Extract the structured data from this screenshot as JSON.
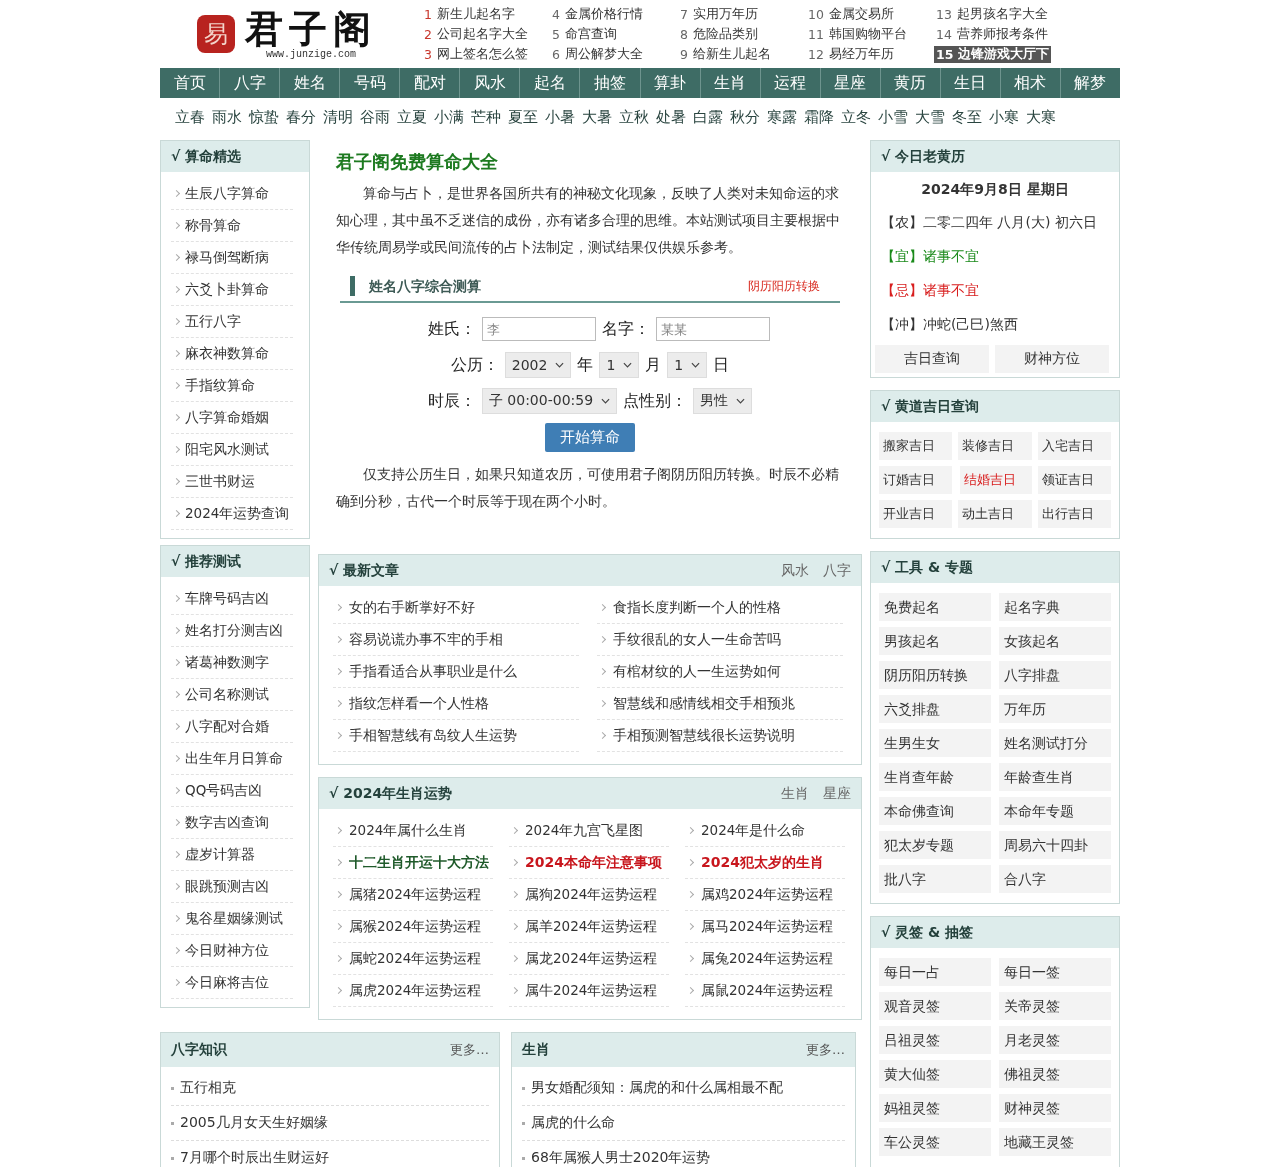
{
  "header": {
    "logo": {
      "seal": "易",
      "name": "君子阁",
      "url": "www.junzige.com"
    },
    "hot_links": [
      {
        "rank": "1",
        "text": "新生儿起名字",
        "top": true,
        "highlighted": false
      },
      {
        "rank": "2",
        "text": "公司起名字大全",
        "top": true,
        "highlighted": false
      },
      {
        "rank": "3",
        "text": "网上签名怎么签",
        "top": true,
        "highlighted": false
      },
      {
        "rank": "4",
        "text": "金属价格行情",
        "top": false,
        "highlighted": false
      },
      {
        "rank": "5",
        "text": "命宫查询",
        "top": false,
        "highlighted": false
      },
      {
        "rank": "6",
        "text": "周公解梦大全",
        "top": false,
        "highlighted": false
      },
      {
        "rank": "7",
        "text": "实用万年历",
        "top": false,
        "highlighted": false
      },
      {
        "rank": "8",
        "text": "危险品类别",
        "top": false,
        "highlighted": false
      },
      {
        "rank": "9",
        "text": "给新生儿起名",
        "top": false,
        "highlighted": false
      },
      {
        "rank": "10",
        "text": "金属交易所",
        "top": false,
        "highlighted": false
      },
      {
        "rank": "11",
        "text": "韩国购物平台",
        "top": false,
        "highlighted": false
      },
      {
        "rank": "12",
        "text": "易经万年历",
        "top": false,
        "highlighted": false
      },
      {
        "rank": "13",
        "text": "起男孩名字大全",
        "top": false,
        "highlighted": false
      },
      {
        "rank": "14",
        "text": "营养师报考条件",
        "top": false,
        "highlighted": false
      },
      {
        "rank": "15",
        "text": "边锋游戏大厅下",
        "top": false,
        "highlighted": true
      }
    ]
  },
  "nav": [
    "首页",
    "八字",
    "姓名",
    "号码",
    "配对",
    "风水",
    "起名",
    "抽签",
    "算卦",
    "生肖",
    "运程",
    "星座",
    "黄历",
    "生日",
    "相术",
    "解梦"
  ],
  "solar_terms": [
    "立春",
    "雨水",
    "惊蛰",
    "春分",
    "清明",
    "谷雨",
    "立夏",
    "小满",
    "芒种",
    "夏至",
    "小暑",
    "大暑",
    "立秋",
    "处暑",
    "白露",
    "秋分",
    "寒露",
    "霜降",
    "立冬",
    "小雪",
    "大雪",
    "冬至",
    "小寒",
    "大寒"
  ],
  "sidebar_sections": [
    {
      "title": "√ 算命精选",
      "items": [
        "生辰八字算命",
        "称骨算命",
        "禄马倒驾断病",
        "六爻卜卦算命",
        "五行八字",
        "麻衣神数算命",
        "手指纹算命",
        "八字算命婚姻",
        "阳宅风水测试",
        "三世书财运",
        "2024年运势查询"
      ]
    },
    {
      "title": "√ 推荐测试",
      "items": [
        "车牌号码吉凶",
        "姓名打分测吉凶",
        "诸葛神数测字",
        "公司名称测试",
        "八字配对合婚",
        "出生年月日算命",
        "QQ号码吉凶",
        "数字吉凶查询",
        "虚岁计算器",
        "眼跳预测吉凶",
        "鬼谷星姻缘测试",
        "今日财神方位",
        "今日麻将吉位"
      ]
    }
  ],
  "intro": {
    "title": "君子阁免费算命大全",
    "paragraphs": [
      "算命与占卜，是世界各国所共有的神秘文化现象，反映了人类对未知命运的求知心理，其中虽不乏迷信的成份，亦有诸多合理的思维。本站测试项目主要根据中华传统周易学或民间流传的占卜法制定，测试结果仅供娱乐参考。"
    ]
  },
  "calculator": {
    "title": "姓名八字综合测算",
    "link": "阴历阳历转换",
    "rows": [
      {
        "fields": [
          {
            "label": "姓氏：",
            "kind": "input",
            "placeholder": "李"
          },
          {
            "label": "名字：",
            "kind": "input",
            "placeholder": "某某"
          }
        ]
      },
      {
        "fields": [
          {
            "label": "公历：",
            "kind": "select",
            "value": "2002",
            "suffix": "年"
          },
          {
            "kind": "select",
            "value": "1",
            "suffix": "月"
          },
          {
            "kind": "select",
            "value": "1",
            "suffix": "日"
          }
        ]
      },
      {
        "fields": [
          {
            "label": "时辰：",
            "kind": "select",
            "value": "子 00:00-00:59"
          },
          {
            "label": "点性别：",
            "kind": "select",
            "value": "男性"
          }
        ]
      }
    ],
    "button": "开始算命",
    "note": "仅支持公历生日，如果只知道农历，可使用君子阁阴历阳历转换。时辰不必精确到分秒，古代一个时辰等于现在两个小时。"
  },
  "articles": {
    "title": "√ 最新文章",
    "tabs": [
      "风水",
      "八字"
    ],
    "items": [
      "女的右手断掌好不好",
      "食指长度判断一个人的性格",
      "容易说谎办事不牢的手相",
      "手纹很乱的女人一生命苦吗",
      "手指看适合从事职业是什么",
      "有棺材纹的人一生运势如何",
      "指纹怎样看一个人性格",
      "智慧线和感情线相交手相预兆",
      "手相智慧线有岛纹人生运势",
      "手相预测智慧线很长运势说明"
    ]
  },
  "zodiac": {
    "title": "√ 2024年生肖运势",
    "tabs": [
      "生肖",
      "星座"
    ],
    "items": [
      {
        "text": "2024年属什么生肖",
        "kind": "normal"
      },
      {
        "text": "2024年九宫飞星图",
        "kind": "normal"
      },
      {
        "text": "2024年是什么命",
        "kind": "normal"
      },
      {
        "text": "十二生肖开运十大方法",
        "kind": "green"
      },
      {
        "text": "2024本命年注意事项",
        "kind": "red"
      },
      {
        "text": "2024犯太岁的生肖",
        "kind": "red"
      },
      {
        "text": "属猪2024年运势运程",
        "kind": "normal"
      },
      {
        "text": "属狗2024年运势运程",
        "kind": "normal"
      },
      {
        "text": "属鸡2024年运势运程",
        "kind": "normal"
      },
      {
        "text": "属猴2024年运势运程",
        "kind": "normal"
      },
      {
        "text": "属羊2024年运势运程",
        "kind": "normal"
      },
      {
        "text": "属马2024年运势运程",
        "kind": "normal"
      },
      {
        "text": "属蛇2024年运势运程",
        "kind": "normal"
      },
      {
        "text": "属龙2024年运势运程",
        "kind": "normal"
      },
      {
        "text": "属兔2024年运势运程",
        "kind": "normal"
      },
      {
        "text": "属虎2024年运势运程",
        "kind": "normal"
      },
      {
        "text": "属牛2024年运势运程",
        "kind": "normal"
      },
      {
        "text": "属鼠2024年运势运程",
        "kind": "normal"
      }
    ]
  },
  "bottom_sections": [
    {
      "title": "八字知识",
      "more": "更多…",
      "items": [
        "五行相克",
        "2005几月女天生好姻缘",
        "7月哪个时辰出生财运好"
      ]
    },
    {
      "title": "生肖",
      "more": "更多…",
      "items": [
        "男女婚配须知：属虎的和什么属相最不配",
        "属虎的什么命",
        "68年属猴人男士2020年运势"
      ]
    }
  ],
  "almanac": {
    "title": "√ 今日老黄历",
    "date": "2024年9月8日 星期日",
    "lines": [
      {
        "kind": "plain",
        "text": "【农】二零二四年 八月(大) 初六日"
      },
      {
        "kind": "good",
        "text": "【宜】诸事不宜"
      },
      {
        "kind": "bad",
        "text": "【忌】诸事不宜"
      },
      {
        "kind": "plain",
        "text": "【冲】冲蛇(己巳)煞西"
      }
    ],
    "buttons": [
      "吉日查询",
      "财神方位"
    ]
  },
  "lucky_days": {
    "title": "√ 黄道吉日查询",
    "items": [
      {
        "text": "搬家吉日",
        "highlighted": false
      },
      {
        "text": "装修吉日",
        "highlighted": false
      },
      {
        "text": "入宅吉日",
        "highlighted": false
      },
      {
        "text": "订婚吉日",
        "highlighted": false
      },
      {
        "text": "结婚吉日",
        "highlighted": true
      },
      {
        "text": "领证吉日",
        "highlighted": false
      },
      {
        "text": "开业吉日",
        "highlighted": false
      },
      {
        "text": "动土吉日",
        "highlighted": false
      },
      {
        "text": "出行吉日",
        "highlighted": false
      }
    ]
  },
  "tools": {
    "title": "√ 工具 & 专题",
    "items": [
      "免费起名",
      "起名字典",
      "男孩起名",
      "女孩起名",
      "阴历阳历转换",
      "八字排盘",
      "六爻排盘",
      "万年历",
      "生男生女",
      "姓名测试打分",
      "生肖查年龄",
      "年龄查生肖",
      "本命佛查询",
      "本命年专题",
      "犯太岁专题",
      "周易六十四卦",
      "批八字",
      "合八字"
    ]
  },
  "oracles": {
    "title": "√ 灵签 & 抽签",
    "items": [
      "每日一占",
      "每日一签",
      "观音灵签",
      "关帝灵签",
      "吕祖灵签",
      "月老灵签",
      "黄大仙签",
      "佛祖灵签",
      "妈祖灵签",
      "财神灵签",
      "车公灵签",
      "地藏王灵签"
    ]
  }
}
